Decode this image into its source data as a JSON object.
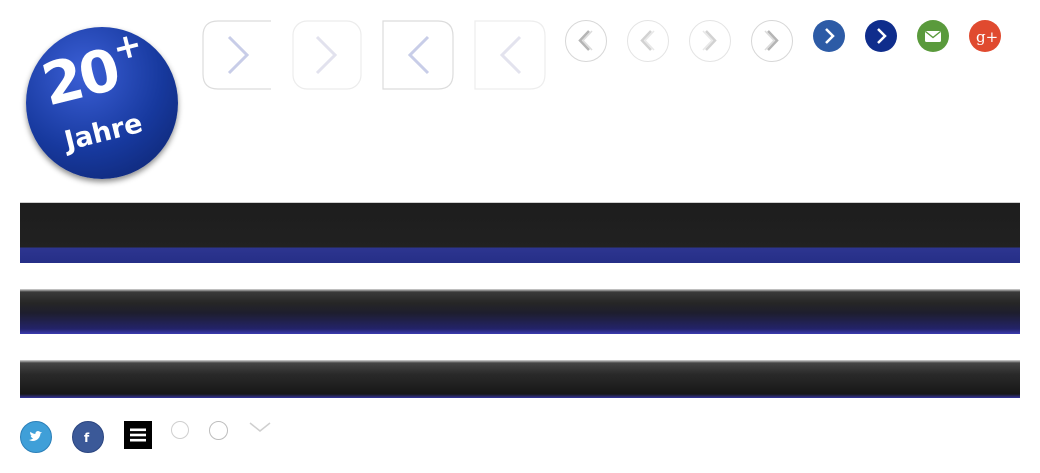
{
  "badge": {
    "number": "20",
    "plus": "+",
    "word": "Jahre"
  },
  "colors": {
    "badge_blue": "#1a3ca3",
    "arrow_blue_light": "#2d5ba6",
    "arrow_blue_dark": "#0f2d8c",
    "mail_green": "#5a9a3c",
    "gplus_red": "#e04a2f",
    "twitter_blue": "#3f9fd8",
    "facebook_blue": "#3b5998",
    "bar_dark": "#1e1e1e",
    "bar_accent": "#2d3590"
  },
  "icons": {
    "square_arrows": [
      "chevron-right-icon",
      "chevron-right-icon",
      "chevron-left-icon",
      "chevron-left-icon"
    ],
    "circle_arrows": [
      "chevron-left-icon",
      "chevron-left-icon",
      "chevron-right-icon",
      "chevron-right-icon"
    ],
    "social_top": [
      "chevron-right-icon",
      "chevron-right-icon",
      "mail-icon",
      "google-plus-icon"
    ],
    "social_bottom": [
      "twitter-icon",
      "facebook-icon",
      "menu-icon",
      "empty-circle-icon",
      "empty-circle-icon",
      "chevron-down-icon"
    ]
  },
  "labels": {
    "facebook": "f",
    "gplus": "g+"
  }
}
